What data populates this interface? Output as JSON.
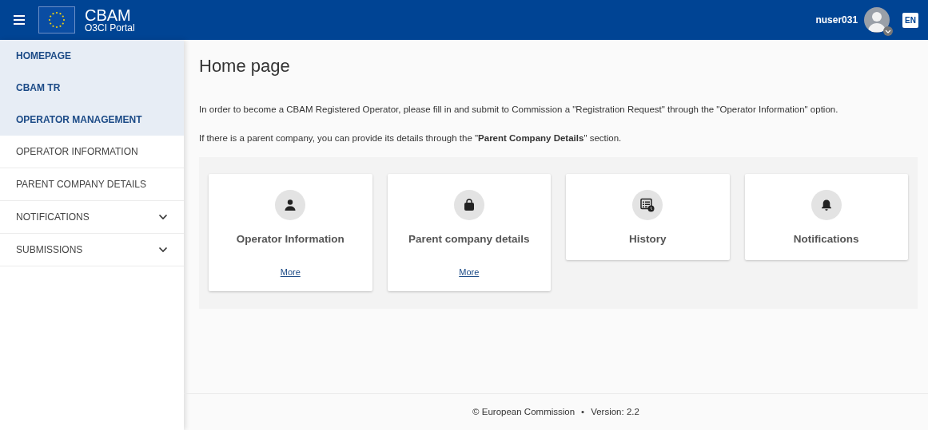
{
  "header": {
    "title": "CBAM",
    "subtitle": "O3CI Portal",
    "username": "nuser031",
    "language": "EN"
  },
  "sidebar": {
    "items": [
      {
        "label": "HOMEPAGE",
        "kind": "heading"
      },
      {
        "label": "CBAM TR",
        "kind": "heading"
      },
      {
        "label": "OPERATOR MANAGEMENT",
        "kind": "heading"
      },
      {
        "label": "OPERATOR INFORMATION",
        "kind": "link"
      },
      {
        "label": "PARENT COMPANY DETAILS",
        "kind": "link"
      },
      {
        "label": "NOTIFICATIONS",
        "kind": "group",
        "expanded": false
      },
      {
        "label": "SUBMISSIONS",
        "kind": "group",
        "expanded": false
      }
    ]
  },
  "page": {
    "title": "Home page",
    "paragraphs": [
      "In order to become a CBAM Registered Operator, please fill in and submit to Commission a \"Registration Request\" through the \"Operator Information\" option.",
      "If there is a parent company, you can provide its details through the \"**Parent Company Details**\" section."
    ]
  },
  "cards": [
    {
      "title": "Operator Information",
      "link": "More"
    },
    {
      "title": "Parent company details",
      "link": "More"
    },
    {
      "title": "History"
    },
    {
      "title": "Notifications"
    }
  ],
  "footer": {
    "copyright": "© European Commission",
    "separator": "•",
    "version": "Version: 2.2"
  }
}
